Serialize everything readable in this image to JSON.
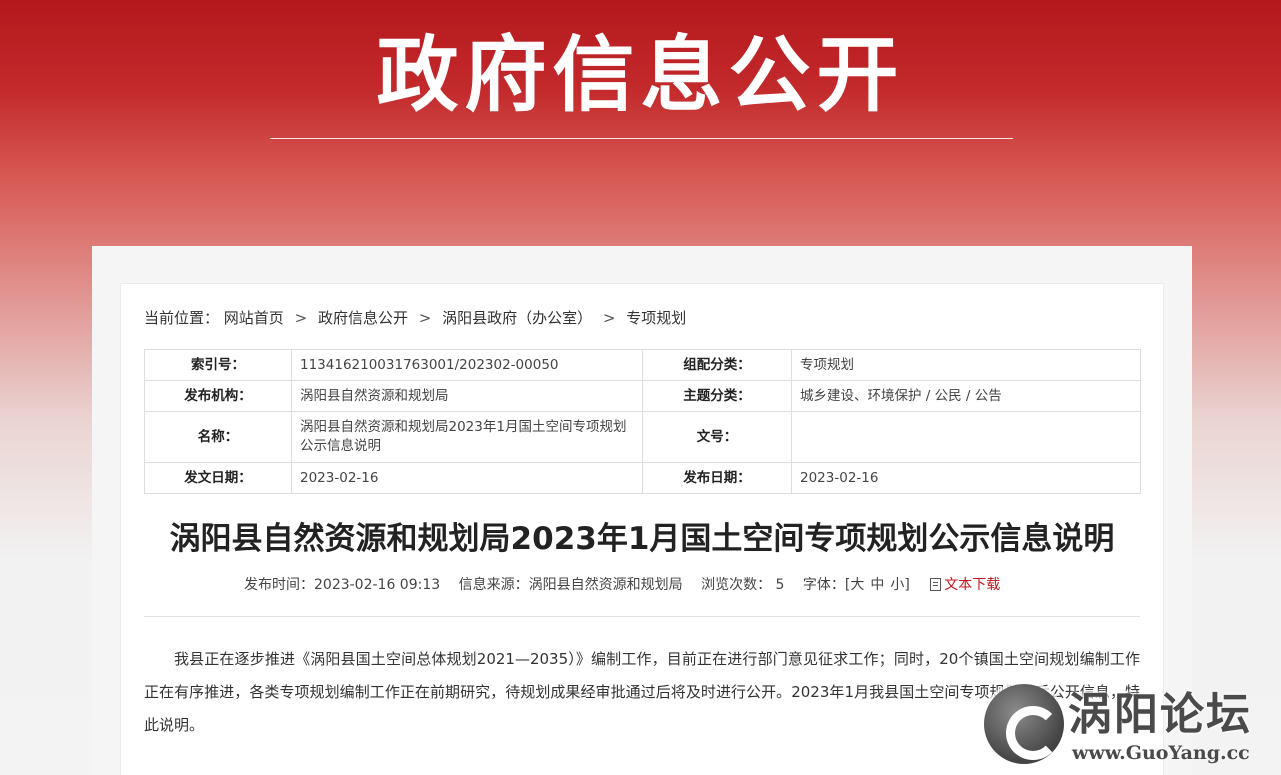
{
  "banner": {
    "title": "政府信息公开"
  },
  "breadcrumb": {
    "prefix": "当前位置：",
    "items": [
      "网站首页",
      "政府信息公开",
      "涡阳县政府（办公室）",
      "专项规划"
    ],
    "sep": ">"
  },
  "meta": {
    "index_no_label": "索引号：",
    "index_no": "113416210031763001/202302-00050",
    "category_label": "组配分类：",
    "category": "专项规划",
    "publisher_label": "发布机构：",
    "publisher": "涡阳县自然资源和规划局",
    "topic_label": "主题分类：",
    "topic": "城乡建设、环境保护 / 公民 / 公告",
    "name_label": "名称：",
    "name": "涡阳县自然资源和规划局2023年1月国土空间专项规划公示信息说明",
    "doc_no_label": "文号：",
    "doc_no": "",
    "issue_date_label": "发文日期：",
    "issue_date": "2023-02-16",
    "publish_date_label": "发布日期：",
    "publish_date": "2023-02-16"
  },
  "article": {
    "title": "涡阳县自然资源和规划局2023年1月国土空间专项规划公示信息说明",
    "publish_time": "发布时间：2023-02-16 09:13",
    "source": "信息来源：涡阳县自然资源和规划局",
    "views": "浏览次数： 5",
    "font_label": "字体：[",
    "font_large": "大",
    "font_medium": "中",
    "font_small": "小",
    "font_end": "]",
    "download": "文本下载",
    "body": "我县正在逐步推进《涡阳县国土空间总体规划2021—2035）》编制工作，目前正在进行部门意见征求工作；同时，20个镇国土空间规划编制工作正在有序推进，各类专项规划编制工作正在前期研究，待规划成果经审批通过后将及时进行公开。2023年1月我县国土空间专项规划批后公开信息，特此说明。"
  },
  "watermark": {
    "name": "涡阳论坛",
    "url": "www.GuoYang.cc"
  }
}
